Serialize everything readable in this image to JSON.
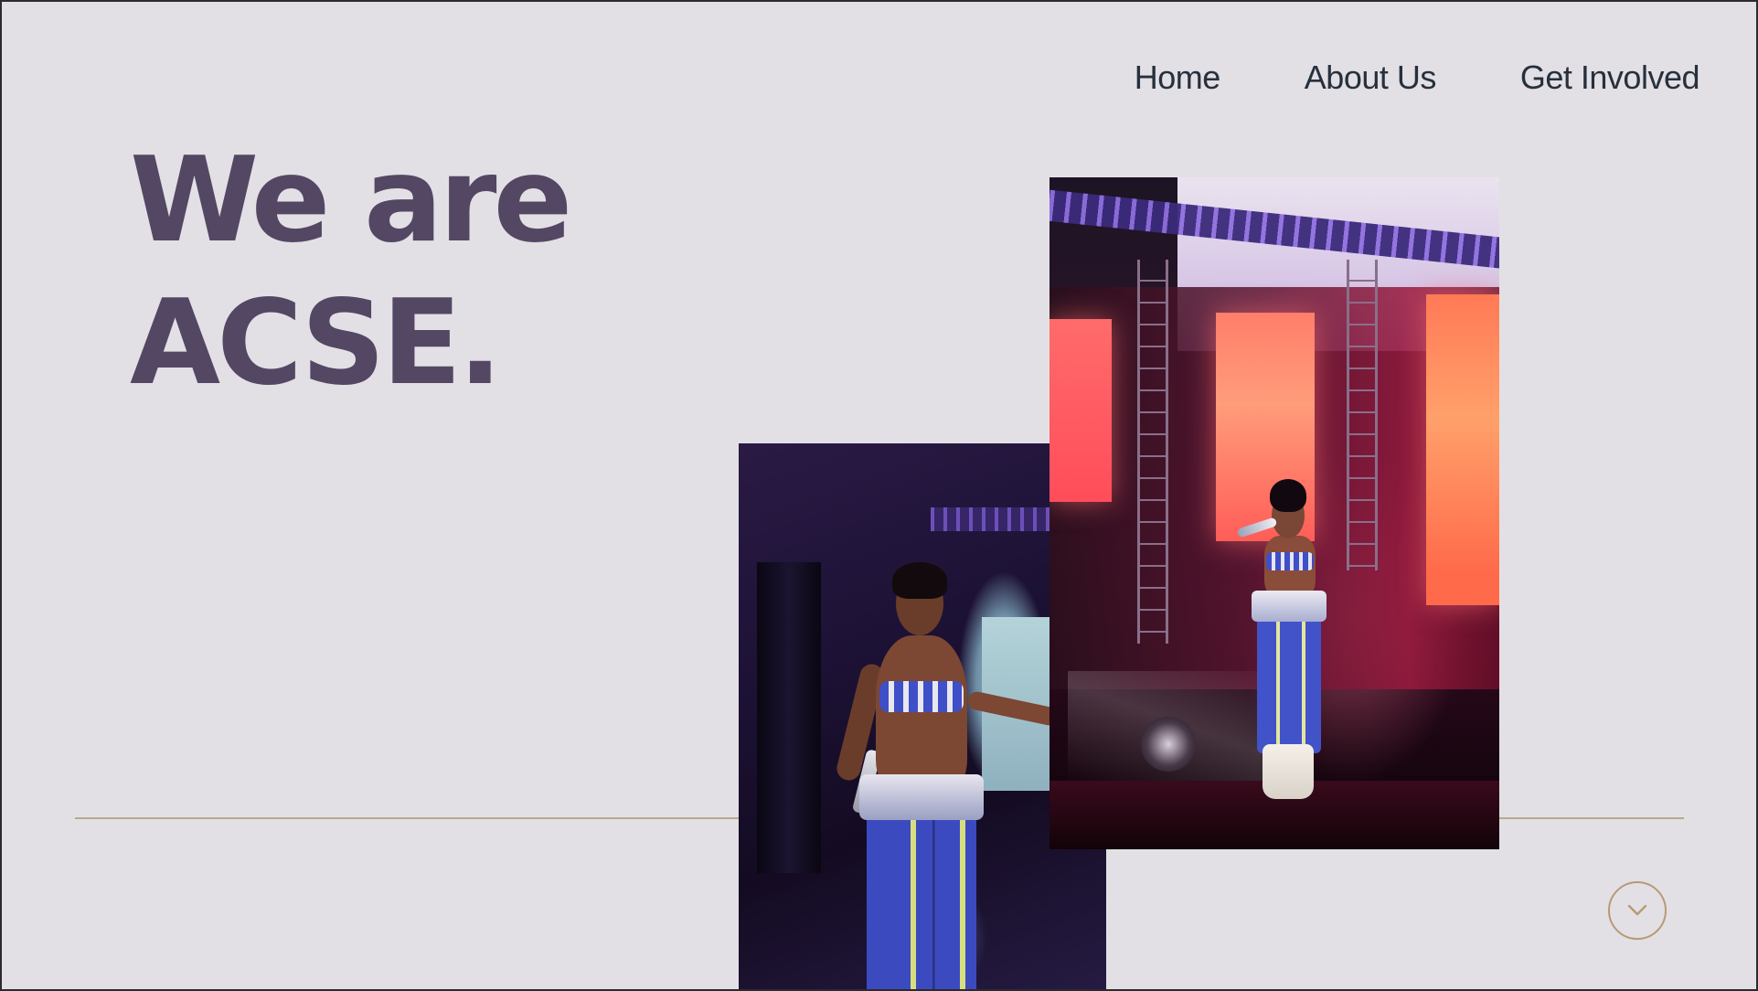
{
  "nav": {
    "items": [
      {
        "label": "Home"
      },
      {
        "label": "About Us"
      },
      {
        "label": "Get Involved"
      }
    ]
  },
  "hero": {
    "title_line1": "We are",
    "title_line2": "ACSE."
  },
  "images": {
    "dance_photo": "performer-dancing-photo",
    "stage_photo": "performer-singing-on-stage-photo"
  },
  "scroll": {
    "icon": "chevron-down-icon"
  },
  "colors": {
    "background": "#e2e0e5",
    "title": "#544764",
    "nav_text": "#27303d",
    "accent_gold": "#b89a74",
    "divider": "#b9a98a"
  }
}
